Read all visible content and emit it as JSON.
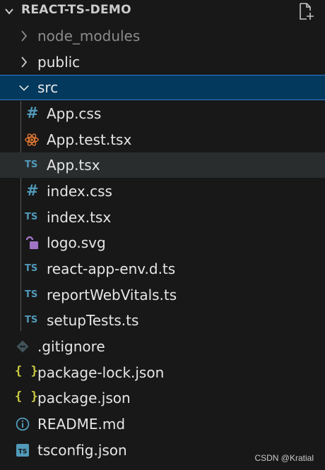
{
  "header": {
    "title": "REACT-TS-DEMO",
    "chevron_icon": "chevron-down-icon",
    "new_file_icon": "new-file-icon"
  },
  "tree": {
    "node_modules": "node_modules",
    "public": "public",
    "src": "src",
    "src_files": {
      "app_css": "App.css",
      "app_test": "App.test.tsx",
      "app_tsx": "App.tsx",
      "index_css": "index.css",
      "index_tsx": "index.tsx",
      "logo": "logo.svg",
      "env": "react-app-env.d.ts",
      "vitals": "reportWebVitals.ts",
      "setup": "setupTests.ts"
    },
    "gitignore": ".gitignore",
    "package_lock": "package-lock.json",
    "package": "package.json",
    "readme": "README.md",
    "tsconfig": "tsconfig.json"
  },
  "icons": {
    "ts": "TS",
    "hash": "#",
    "curly": "{ }"
  },
  "colors": {
    "background": "#181818",
    "selected": "#04395e",
    "selected_border": "#2b79d0",
    "ts_blue": "#519aba",
    "json_yellow": "#cbcb41",
    "react_orange": "#e37933",
    "svg_purple": "#a074c4"
  },
  "watermark": "CSDN @Kratial"
}
